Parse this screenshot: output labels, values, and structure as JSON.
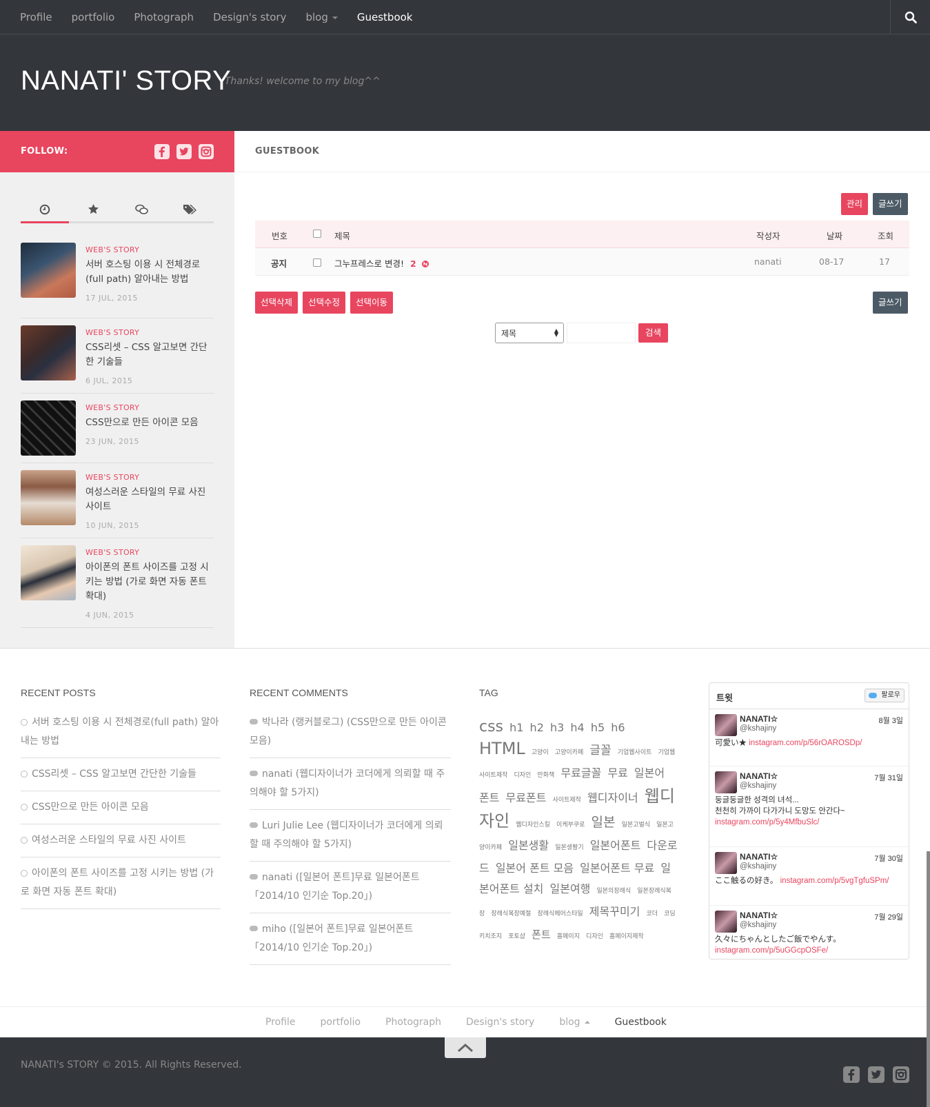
{
  "nav": {
    "items": [
      {
        "label": "Profile"
      },
      {
        "label": "portfolio"
      },
      {
        "label": "Photograph"
      },
      {
        "label": "Design's story"
      },
      {
        "label": "blog"
      },
      {
        "label": "Guestbook"
      }
    ],
    "search_icon": "search-icon"
  },
  "header": {
    "title": "NANATI' STORY",
    "tagline": "Thanks! welcome to my blog^^"
  },
  "sidebar": {
    "follow_label": "FOLLOW:",
    "tabs": [
      "clock-icon",
      "star-icon",
      "comments-icon",
      "tags-icon"
    ],
    "posts": [
      {
        "category": "WEB'S STORY",
        "title": "서버 호스팅 이용 시 전체경로(full path) 알아내는 방법",
        "date": "17 JUL, 2015"
      },
      {
        "category": "WEB'S STORY",
        "title": "CSS리셋 – CSS 알고보면 간단한 기술들",
        "date": "6 JUL, 2015"
      },
      {
        "category": "WEB'S STORY",
        "title": "CSS만으로 만든 아이콘 모음",
        "date": "23 JUN, 2015"
      },
      {
        "category": "WEB'S STORY",
        "title": "여성스러운 스타일의 무료 사진 사이트",
        "date": "10 JUN, 2015"
      },
      {
        "category": "WEB'S STORY",
        "title": "아이폰의 폰트 사이즈를 고정 시키는 방법 (가로 화면 자동 폰트 확대)",
        "date": "4 JUN, 2015"
      }
    ]
  },
  "main": {
    "heading": "GUESTBOOK",
    "admin_btn": "관리",
    "write_btn": "글쓰기",
    "table": {
      "headers": {
        "num": "번호",
        "title": "제목",
        "author": "작성자",
        "date": "날짜",
        "views": "조회"
      },
      "rows": [
        {
          "num": "공지",
          "title": "그누프레스로 변경!",
          "comments": "2",
          "author": "nanati",
          "date": "08-17",
          "views": "17"
        }
      ]
    },
    "actions": {
      "delete": "선택삭제",
      "edit": "선택수정",
      "move": "선택이동",
      "write": "글쓰기"
    },
    "search": {
      "field": "제목",
      "button": "검색"
    }
  },
  "footer": {
    "recent_posts": {
      "title": "RECENT POSTS",
      "items": [
        "서버 호스팅 이용 시 전체경로(full path) 알아내는 방법",
        "CSS리셋 – CSS 알고보면 간단한 기술들",
        "CSS만으로 만든 아이콘 모음",
        "여성스러운 스타일의 무료 사진 사이트",
        "아이폰의 폰트 사이즈를 고정 시키는 방법 (가로 화면 자동 폰트 확대)"
      ]
    },
    "recent_comments": {
      "title": "RECENT COMMENTS",
      "items": [
        "박나라 (랭커블로그) (CSS만으로 만든 아이콘 모음)",
        "nanati (웹디자이너가 코더에게 의뢰할 때 주의해야 할 5가지)",
        "Luri Julie Lee (웹디자이너가 코더에게 의뢰할 때 주의해야 할 5가지)",
        "nanati ([일본어 폰트]무료 일본어폰트 「2014/10 인기순 Top.20」)",
        "miho ([일본어 폰트]무료 일본어폰트 「2014/10 인기순 Top.20」)"
      ]
    },
    "tag": {
      "title": "TAG",
      "items": [
        "css",
        "h1",
        "h2",
        "h3",
        "h4",
        "h5",
        "h6",
        "HTML",
        "고양이",
        "고양이카페",
        "글꼴",
        "기업웹사이트",
        "기업웹사이트제작",
        "디자인",
        "만화책",
        "무료글꼴",
        "무료",
        "일본어",
        "폰트",
        "무료폰트",
        "사이트제작",
        "웹디자이너",
        "웹디자인",
        "웹디자인스킬",
        "이케부쿠로",
        "일본",
        "일본고벌식",
        "일본고양이카페",
        "일본생활",
        "일본생활기",
        "일본어폰트",
        "다운로드",
        "일본어 폰트 모음",
        "일본어폰트 무료",
        "일본어폰트 설치",
        "일본여행",
        "일본의장례식",
        "일본장례식복장",
        "장례식복장예절",
        "장례식헤어스타일",
        "제목꾸미기",
        "코더",
        "코딩",
        "키치조지",
        "포토샵",
        "폰트",
        "홈페이지",
        "디자인",
        "홈페이지제작"
      ]
    },
    "tweets": {
      "title": "트윗",
      "follow": "팔로우",
      "items": [
        {
          "name": "NANATI☆",
          "handle": "@kshajiny",
          "date": "8월 3일",
          "text": "可愛い★ ",
          "link": "instagram.com/p/56rOAROSDp/"
        },
        {
          "name": "NANATI☆",
          "handle": "@kshajiny",
          "date": "7월 31일",
          "text": "둥글둥글한 성격의 녀석...\n천천히 가까이 다가가니 도망도 안간다~ ",
          "link": "instagram.com/p/5y4MfbuSlc/"
        },
        {
          "name": "NANATI☆",
          "handle": "@kshajiny",
          "date": "7월 30일",
          "text": "ここ触るの好き。 ",
          "link": "instagram.com/p/5vgTgfuSPm/"
        },
        {
          "name": "NANATI☆",
          "handle": "@kshajiny",
          "date": "7월 29일",
          "text": "久々にちゃんとしたご飯でやんす。 ",
          "link": "instagram.com/p/5uGGcpOSFe/"
        }
      ]
    },
    "bottom_nav": [
      {
        "label": "Profile"
      },
      {
        "label": "portfolio"
      },
      {
        "label": "Photograph"
      },
      {
        "label": "Design's story"
      },
      {
        "label": "blog"
      },
      {
        "label": "Guestbook"
      }
    ],
    "copyright": "NANATI's STORY © 2015. All Rights Reserved."
  },
  "colors": {
    "accent": "#e8455f",
    "dark": "#33363b",
    "button_dark": "#4c5a66"
  }
}
